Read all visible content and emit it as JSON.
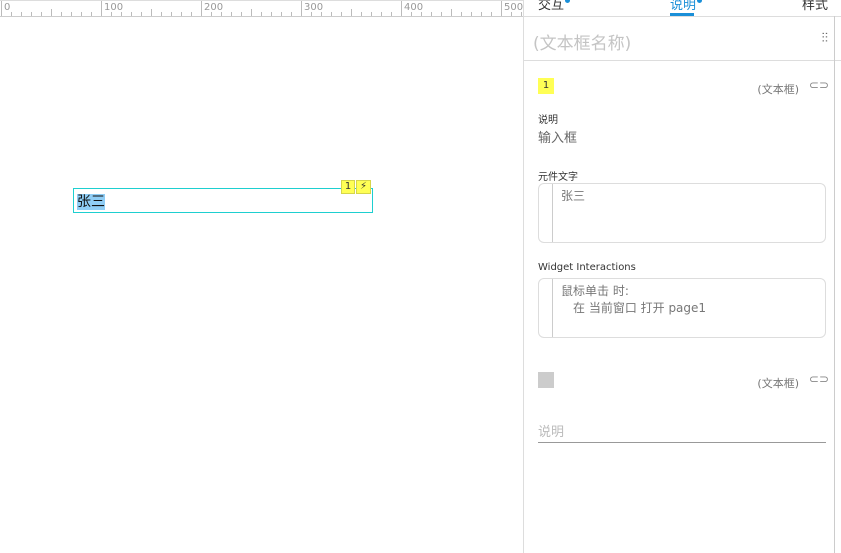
{
  "ruler": {
    "labels": [
      "0",
      "100",
      "200",
      "300",
      "400",
      "500"
    ]
  },
  "canvas": {
    "widget": {
      "text": "张三",
      "note_number": "1",
      "interaction_icon": "lightning-icon"
    }
  },
  "panel": {
    "tabs": [
      {
        "label": "交互"
      },
      {
        "label": "说明",
        "active": true
      },
      {
        "label": "样式"
      }
    ],
    "widget_name_placeholder": "(文本框名称)",
    "adjust_icon": "sliders-icon",
    "notes": [
      {
        "number": "1",
        "type": "(文本框)",
        "color": "#ffff55",
        "desc_label": "说明",
        "desc_value": "输入框",
        "text_label": "元件文字",
        "text_value": "张三",
        "interactions_label": "Widget Interactions",
        "interactions": [
          "鼠标单击 时:",
          "在 当前窗口 打开 page1"
        ]
      },
      {
        "number": "",
        "type": "(文本框)",
        "color": "#cccccc",
        "desc_placeholder": "说明"
      }
    ]
  },
  "colors": {
    "accent": "#1a8fd8",
    "note": "#ffff55",
    "selection": "#1ecfd0"
  }
}
